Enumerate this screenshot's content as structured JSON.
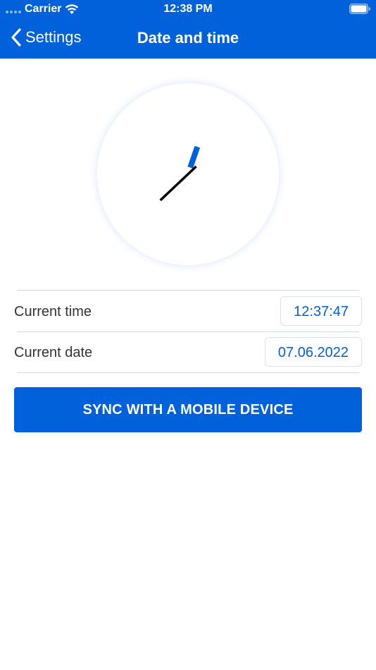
{
  "status_bar": {
    "carrier": "Carrier",
    "time": "12:38 PM",
    "icons": [
      "signal-dots-icon",
      "wifi-icon",
      "battery-icon"
    ]
  },
  "nav": {
    "back_label": "Settings",
    "title": "Date and time",
    "back_icon": "chevron-left-icon"
  },
  "clock": {
    "hour": 12,
    "minute": 37,
    "second": 47,
    "hour_hand_color": "#0061DB",
    "minute_hand_color": "#000000"
  },
  "rows": [
    {
      "label": "Current time",
      "value": "12:37:47"
    },
    {
      "label": "Current date",
      "value": "07.06.2022"
    }
  ],
  "sync_button": {
    "label": "SYNC WITH A MOBILE DEVICE"
  },
  "colors": {
    "accent": "#0061DB",
    "text": "#333333",
    "divider": "#d8d8d8"
  }
}
